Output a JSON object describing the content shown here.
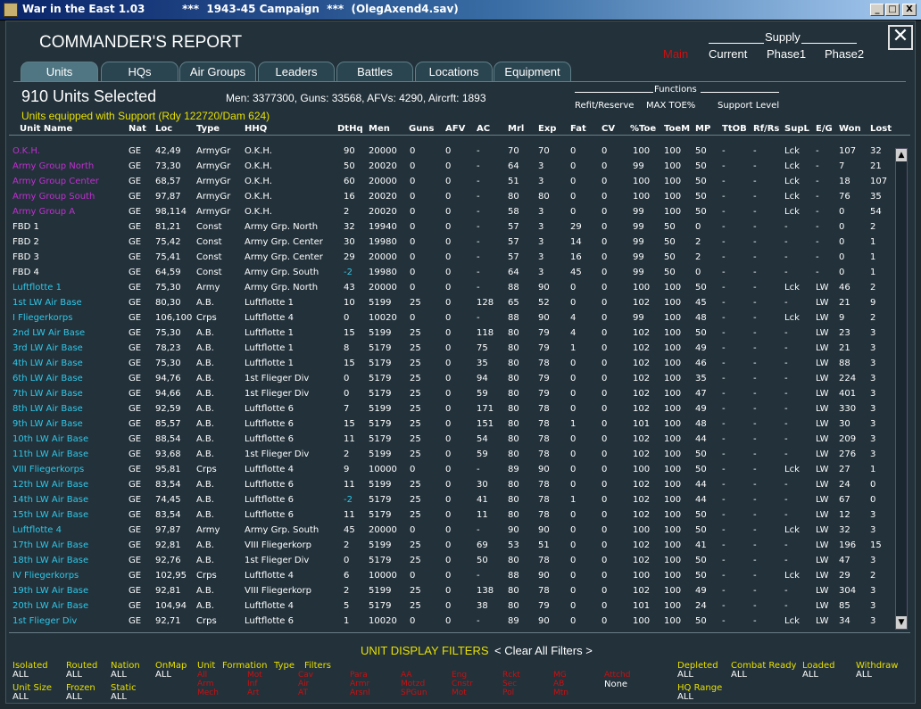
{
  "window": {
    "title": "War in the East 1.03          ***  1943-45 Campaign  ***  (OlegAxend4.sav)",
    "min_label": "_",
    "max_label": "□",
    "close_label": "X"
  },
  "header": {
    "title": "COMMANDER'S REPORT",
    "close_glyph": "✕",
    "supply_label": "Supply",
    "supply_options": [
      "Main",
      "Current",
      "Phase1",
      "Phase2"
    ]
  },
  "tabs": [
    "Units",
    "HQs",
    "Air Groups",
    "Leaders",
    "Battles",
    "Locations",
    "Equipment"
  ],
  "summary": {
    "selected": "910 Units Selected",
    "stats": "Men: 3377300, Guns: 33568, AFVs: 4290, Aircrft: 1893",
    "support": "Units equipped with Support (Rdy 122720/Dam 624)"
  },
  "functions": {
    "label": "Functions",
    "options": [
      "Refit/Reserve",
      "MAX TOE%",
      "Support Level"
    ]
  },
  "columns": [
    "Unit Name",
    "Nat",
    "Loc",
    "Type",
    "HHQ",
    "DtHq",
    "Men",
    "Guns",
    "AFV",
    "AC",
    "Mrl",
    "Exp",
    "Fat",
    "CV",
    "%Toe",
    "ToeM",
    "MP",
    "TtOB",
    "Rf/Rs",
    "SupL",
    "E/G",
    "Won",
    "Lost"
  ],
  "rows": [
    {
      "name": "O.K.H.",
      "kind": "army",
      "c": [
        "GE",
        "42,49",
        "ArmyGr",
        "O.K.H.",
        "90",
        "20000",
        "0",
        "0",
        "-",
        "70",
        "70",
        "0",
        "0",
        "100",
        "100",
        "50",
        "-",
        "-",
        "Lck",
        "-",
        "107",
        "32"
      ]
    },
    {
      "name": "Army Group North",
      "kind": "army",
      "c": [
        "GE",
        "73,30",
        "ArmyGr",
        "O.K.H.",
        "50",
        "20020",
        "0",
        "0",
        "-",
        "64",
        "3",
        "0",
        "0",
        "99",
        "100",
        "50",
        "-",
        "-",
        "Lck",
        "-",
        "7",
        "21"
      ]
    },
    {
      "name": "Army Group Center",
      "kind": "army",
      "c": [
        "GE",
        "68,57",
        "ArmyGr",
        "O.K.H.",
        "60",
        "20000",
        "0",
        "0",
        "-",
        "51",
        "3",
        "0",
        "0",
        "100",
        "100",
        "50",
        "-",
        "-",
        "Lck",
        "-",
        "18",
        "107"
      ]
    },
    {
      "name": "Army Group South",
      "kind": "army",
      "c": [
        "GE",
        "97,87",
        "ArmyGr",
        "O.K.H.",
        "16",
        "20020",
        "0",
        "0",
        "-",
        "80",
        "80",
        "0",
        "0",
        "100",
        "100",
        "50",
        "-",
        "-",
        "Lck",
        "-",
        "76",
        "35"
      ]
    },
    {
      "name": "Army Group A",
      "kind": "army",
      "c": [
        "GE",
        "98,114",
        "ArmyGr",
        "O.K.H.",
        "2",
        "20020",
        "0",
        "0",
        "-",
        "58",
        "3",
        "0",
        "0",
        "99",
        "100",
        "50",
        "-",
        "-",
        "Lck",
        "-",
        "0",
        "54"
      ]
    },
    {
      "name": "FBD 1",
      "kind": "fbd",
      "c": [
        "GE",
        "81,21",
        "Const",
        "Army Grp. North",
        "32",
        "19940",
        "0",
        "0",
        "-",
        "57",
        "3",
        "29",
        "0",
        "99",
        "50",
        "0",
        "-",
        "-",
        "-",
        "-",
        "0",
        "2"
      ]
    },
    {
      "name": "FBD 2",
      "kind": "fbd",
      "c": [
        "GE",
        "75,42",
        "Const",
        "Army Grp. Center",
        "30",
        "19980",
        "0",
        "0",
        "-",
        "57",
        "3",
        "14",
        "0",
        "99",
        "50",
        "2",
        "-",
        "-",
        "-",
        "-",
        "0",
        "1"
      ]
    },
    {
      "name": "FBD 3",
      "kind": "fbd",
      "c": [
        "GE",
        "75,41",
        "Const",
        "Army Grp. Center",
        "29",
        "20000",
        "0",
        "0",
        "-",
        "57",
        "3",
        "16",
        "0",
        "99",
        "50",
        "2",
        "-",
        "-",
        "-",
        "-",
        "0",
        "1"
      ]
    },
    {
      "name": "FBD 4",
      "kind": "fbd",
      "dtcyan": true,
      "c": [
        "GE",
        "64,59",
        "Const",
        "Army Grp. South",
        "-2",
        "19980",
        "0",
        "0",
        "-",
        "64",
        "3",
        "45",
        "0",
        "99",
        "50",
        "0",
        "-",
        "-",
        "-",
        "-",
        "0",
        "1"
      ]
    },
    {
      "name": "Luftflotte 1",
      "kind": "air",
      "c": [
        "GE",
        "75,30",
        "Army",
        "Army Grp. North",
        "43",
        "20000",
        "0",
        "0",
        "-",
        "88",
        "90",
        "0",
        "0",
        "100",
        "100",
        "50",
        "-",
        "-",
        "Lck",
        "LW",
        "46",
        "2"
      ]
    },
    {
      "name": "1st LW Air Base",
      "kind": "air",
      "c": [
        "GE",
        "80,30",
        "A.B.",
        "Luftflotte 1",
        "10",
        "5199",
        "25",
        "0",
        "128",
        "65",
        "52",
        "0",
        "0",
        "102",
        "100",
        "45",
        "-",
        "-",
        "-",
        "LW",
        "21",
        "9"
      ]
    },
    {
      "name": "I Fliegerkorps",
      "kind": "air",
      "c": [
        "GE",
        "106,100",
        "Crps",
        "Luftflotte 4",
        "0",
        "10020",
        "0",
        "0",
        "-",
        "88",
        "90",
        "4",
        "0",
        "99",
        "100",
        "48",
        "-",
        "-",
        "Lck",
        "LW",
        "9",
        "2"
      ]
    },
    {
      "name": "2nd LW Air Base",
      "kind": "air",
      "c": [
        "GE",
        "75,30",
        "A.B.",
        "Luftflotte 1",
        "15",
        "5199",
        "25",
        "0",
        "118",
        "80",
        "79",
        "4",
        "0",
        "102",
        "100",
        "50",
        "-",
        "-",
        "-",
        "LW",
        "23",
        "3"
      ]
    },
    {
      "name": "3rd LW Air Base",
      "kind": "air",
      "c": [
        "GE",
        "78,23",
        "A.B.",
        "Luftflotte 1",
        "8",
        "5179",
        "25",
        "0",
        "75",
        "80",
        "79",
        "1",
        "0",
        "102",
        "100",
        "49",
        "-",
        "-",
        "-",
        "LW",
        "21",
        "3"
      ]
    },
    {
      "name": "4th LW Air Base",
      "kind": "air",
      "c": [
        "GE",
        "75,30",
        "A.B.",
        "Luftflotte 1",
        "15",
        "5179",
        "25",
        "0",
        "35",
        "80",
        "78",
        "0",
        "0",
        "102",
        "100",
        "46",
        "-",
        "-",
        "-",
        "LW",
        "88",
        "3"
      ]
    },
    {
      "name": "6th LW Air Base",
      "kind": "air",
      "c": [
        "GE",
        "94,76",
        "A.B.",
        "1st Flieger Div",
        "0",
        "5179",
        "25",
        "0",
        "94",
        "80",
        "79",
        "0",
        "0",
        "102",
        "100",
        "35",
        "-",
        "-",
        "-",
        "LW",
        "224",
        "3"
      ]
    },
    {
      "name": "7th LW Air Base",
      "kind": "air",
      "c": [
        "GE",
        "94,66",
        "A.B.",
        "1st Flieger Div",
        "0",
        "5179",
        "25",
        "0",
        "59",
        "80",
        "79",
        "0",
        "0",
        "102",
        "100",
        "47",
        "-",
        "-",
        "-",
        "LW",
        "401",
        "3"
      ]
    },
    {
      "name": "8th LW Air Base",
      "kind": "air",
      "c": [
        "GE",
        "92,59",
        "A.B.",
        "Luftflotte 6",
        "7",
        "5199",
        "25",
        "0",
        "171",
        "80",
        "78",
        "0",
        "0",
        "102",
        "100",
        "49",
        "-",
        "-",
        "-",
        "LW",
        "330",
        "3"
      ]
    },
    {
      "name": "9th LW Air Base",
      "kind": "air",
      "c": [
        "GE",
        "85,57",
        "A.B.",
        "Luftflotte 6",
        "15",
        "5179",
        "25",
        "0",
        "151",
        "80",
        "78",
        "1",
        "0",
        "101",
        "100",
        "48",
        "-",
        "-",
        "-",
        "LW",
        "30",
        "3"
      ]
    },
    {
      "name": "10th LW Air Base",
      "kind": "air",
      "c": [
        "GE",
        "88,54",
        "A.B.",
        "Luftflotte 6",
        "11",
        "5179",
        "25",
        "0",
        "54",
        "80",
        "78",
        "0",
        "0",
        "102",
        "100",
        "44",
        "-",
        "-",
        "-",
        "LW",
        "209",
        "3"
      ]
    },
    {
      "name": "11th LW Air Base",
      "kind": "air",
      "c": [
        "GE",
        "93,68",
        "A.B.",
        "1st Flieger Div",
        "2",
        "5199",
        "25",
        "0",
        "59",
        "80",
        "78",
        "0",
        "0",
        "102",
        "100",
        "50",
        "-",
        "-",
        "-",
        "LW",
        "276",
        "3"
      ]
    },
    {
      "name": "VIII Fliegerkorps",
      "kind": "air",
      "c": [
        "GE",
        "95,81",
        "Crps",
        "Luftflotte 4",
        "9",
        "10000",
        "0",
        "0",
        "-",
        "89",
        "90",
        "0",
        "0",
        "100",
        "100",
        "50",
        "-",
        "-",
        "Lck",
        "LW",
        "27",
        "1"
      ]
    },
    {
      "name": "12th LW Air Base",
      "kind": "air",
      "c": [
        "GE",
        "83,54",
        "A.B.",
        "Luftflotte 6",
        "11",
        "5199",
        "25",
        "0",
        "30",
        "80",
        "78",
        "0",
        "0",
        "102",
        "100",
        "44",
        "-",
        "-",
        "-",
        "LW",
        "24",
        "0"
      ]
    },
    {
      "name": "14th LW Air Base",
      "kind": "air",
      "dtcyan": true,
      "c": [
        "GE",
        "74,45",
        "A.B.",
        "Luftflotte 6",
        "-2",
        "5179",
        "25",
        "0",
        "41",
        "80",
        "78",
        "1",
        "0",
        "102",
        "100",
        "44",
        "-",
        "-",
        "-",
        "LW",
        "67",
        "0"
      ]
    },
    {
      "name": "15th LW Air Base",
      "kind": "air",
      "c": [
        "GE",
        "83,54",
        "A.B.",
        "Luftflotte 6",
        "11",
        "5179",
        "25",
        "0",
        "11",
        "80",
        "78",
        "0",
        "0",
        "102",
        "100",
        "50",
        "-",
        "-",
        "-",
        "LW",
        "12",
        "3"
      ]
    },
    {
      "name": "Luftflotte 4",
      "kind": "air",
      "c": [
        "GE",
        "97,87",
        "Army",
        "Army Grp. South",
        "45",
        "20000",
        "0",
        "0",
        "-",
        "90",
        "90",
        "0",
        "0",
        "100",
        "100",
        "50",
        "-",
        "-",
        "Lck",
        "LW",
        "32",
        "3"
      ]
    },
    {
      "name": "17th LW Air Base",
      "kind": "air",
      "c": [
        "GE",
        "92,81",
        "A.B.",
        "VIII Fliegerkorp",
        "2",
        "5199",
        "25",
        "0",
        "69",
        "53",
        "51",
        "0",
        "0",
        "102",
        "100",
        "41",
        "-",
        "-",
        "-",
        "LW",
        "196",
        "15"
      ]
    },
    {
      "name": "18th LW Air Base",
      "kind": "air",
      "c": [
        "GE",
        "92,76",
        "A.B.",
        "1st Flieger Div",
        "0",
        "5179",
        "25",
        "0",
        "50",
        "80",
        "78",
        "0",
        "0",
        "102",
        "100",
        "50",
        "-",
        "-",
        "-",
        "LW",
        "47",
        "3"
      ]
    },
    {
      "name": "IV Fliegerkorps",
      "kind": "air",
      "c": [
        "GE",
        "102,95",
        "Crps",
        "Luftflotte 4",
        "6",
        "10000",
        "0",
        "0",
        "-",
        "88",
        "90",
        "0",
        "0",
        "100",
        "100",
        "50",
        "-",
        "-",
        "Lck",
        "LW",
        "29",
        "2"
      ]
    },
    {
      "name": "19th LW Air Base",
      "kind": "air",
      "c": [
        "GE",
        "92,81",
        "A.B.",
        "VIII Fliegerkorp",
        "2",
        "5199",
        "25",
        "0",
        "138",
        "80",
        "78",
        "0",
        "0",
        "102",
        "100",
        "49",
        "-",
        "-",
        "-",
        "LW",
        "304",
        "3"
      ]
    },
    {
      "name": "20th LW Air Base",
      "kind": "air",
      "c": [
        "GE",
        "104,94",
        "A.B.",
        "Luftflotte 4",
        "5",
        "5179",
        "25",
        "0",
        "38",
        "80",
        "79",
        "0",
        "0",
        "101",
        "100",
        "24",
        "-",
        "-",
        "-",
        "LW",
        "85",
        "3"
      ]
    },
    {
      "name": "1st Flieger Div",
      "kind": "air",
      "c": [
        "GE",
        "92,71",
        "Crps",
        "Luftflotte 6",
        "1",
        "10020",
        "0",
        "0",
        "-",
        "89",
        "90",
        "0",
        "0",
        "100",
        "100",
        "50",
        "-",
        "-",
        "Lck",
        "LW",
        "34",
        "3"
      ]
    }
  ],
  "scroll": {
    "up": "▲",
    "down": "▼"
  },
  "filters": {
    "title": "UNIT DISPLAY FILTERS",
    "clear": "< Clear All Filters >",
    "groups": [
      {
        "label": "Isolated",
        "value": "ALL"
      },
      {
        "label": "Routed",
        "value": "ALL"
      },
      {
        "label": "Nation",
        "value": "ALL"
      },
      {
        "label": "OnMap",
        "value": "ALL"
      },
      {
        "label": "Unit Size",
        "value": "ALL"
      },
      {
        "label": "Frozen",
        "value": "ALL"
      },
      {
        "label": "Static",
        "value": "ALL"
      },
      {
        "label": "Depleted",
        "value": "ALL"
      },
      {
        "label": "Combat Ready",
        "value": "ALL"
      },
      {
        "label": "Loaded",
        "value": "ALL"
      },
      {
        "label": "Withdraw",
        "value": "ALL"
      },
      {
        "label": "HQ Range",
        "value": "ALL"
      }
    ],
    "unit_label": "Unit",
    "formation_label": "Formation",
    "type_label": "Type",
    "filters_label": "Filters",
    "none_label": "None",
    "red_columns": [
      [
        "All",
        "Arm",
        "Mech"
      ],
      [
        "Mot",
        "Inf",
        "Art"
      ],
      [
        "Cav",
        "Air",
        "AT"
      ],
      [
        "Para",
        "Armr",
        "Arsnl"
      ],
      [
        "AA",
        "Motzd",
        "SPGun"
      ],
      [
        "Eng",
        "Cnstr",
        "Mot"
      ],
      [
        "Rckt",
        "Sec",
        "Pol"
      ],
      [
        "MG",
        "AB",
        "Mtn"
      ],
      [
        "Attchd"
      ]
    ]
  },
  "colors": {
    "army_name": "#c030d0",
    "air_name": "#30c8e8",
    "highlight_yellow": "#e8e000",
    "active_red": "#cc1010"
  }
}
